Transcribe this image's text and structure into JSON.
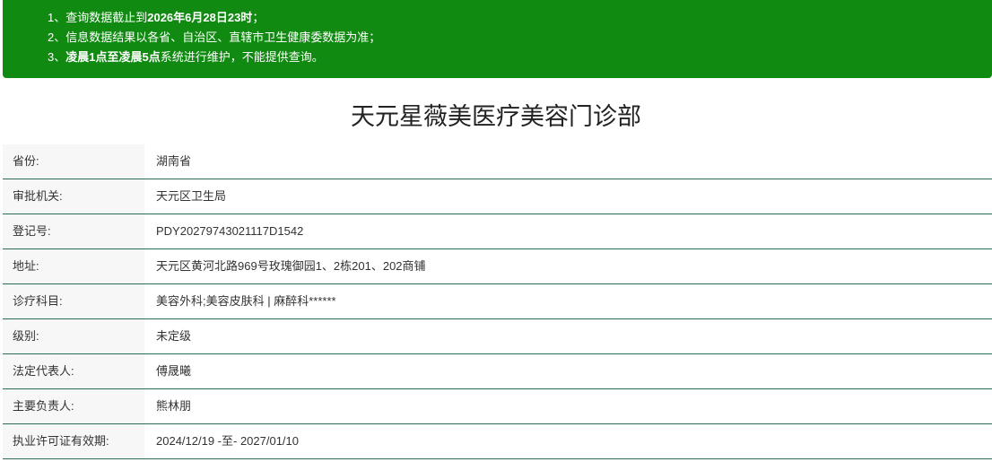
{
  "notice": {
    "line1": {
      "prefix": "1、查询数据截止到",
      "highlight": "2026年6月28日23时",
      "suffix": "；"
    },
    "line2": {
      "text": "2、信息数据结果以各省、自治区、直辖市卫生健康委数据为准；"
    },
    "line3": {
      "prefix": "3、",
      "highlight": "凌晨1点至凌晨5点",
      "suffix": "系统进行维护，不能提供查询。"
    }
  },
  "title": "天元星薇美医疗美容门诊部",
  "details": [
    {
      "label": "省份:",
      "value": "湖南省"
    },
    {
      "label": "审批机关:",
      "value": "天元区卫生局"
    },
    {
      "label": "登记号:",
      "value": "PDY20279743021117D1542"
    },
    {
      "label": "地址:",
      "value": "天元区黄河北路969号玫瑰御园1、2栋201、202商铺"
    },
    {
      "label": "诊疗科目:",
      "value": "美容外科;美容皮肤科 | 麻醉科******"
    },
    {
      "label": "级别:",
      "value": "未定级"
    },
    {
      "label": "法定代表人:",
      "value": "傅晟曦"
    },
    {
      "label": "主要负责人:",
      "value": "熊林朋"
    },
    {
      "label": "执业许可证有效期:",
      "value": "2024/12/19 -至- 2027/01/10"
    }
  ],
  "colors": {
    "notice_background": "#118a12",
    "row_border": "#2c6a5c",
    "label_background": "#f7f7f7"
  }
}
